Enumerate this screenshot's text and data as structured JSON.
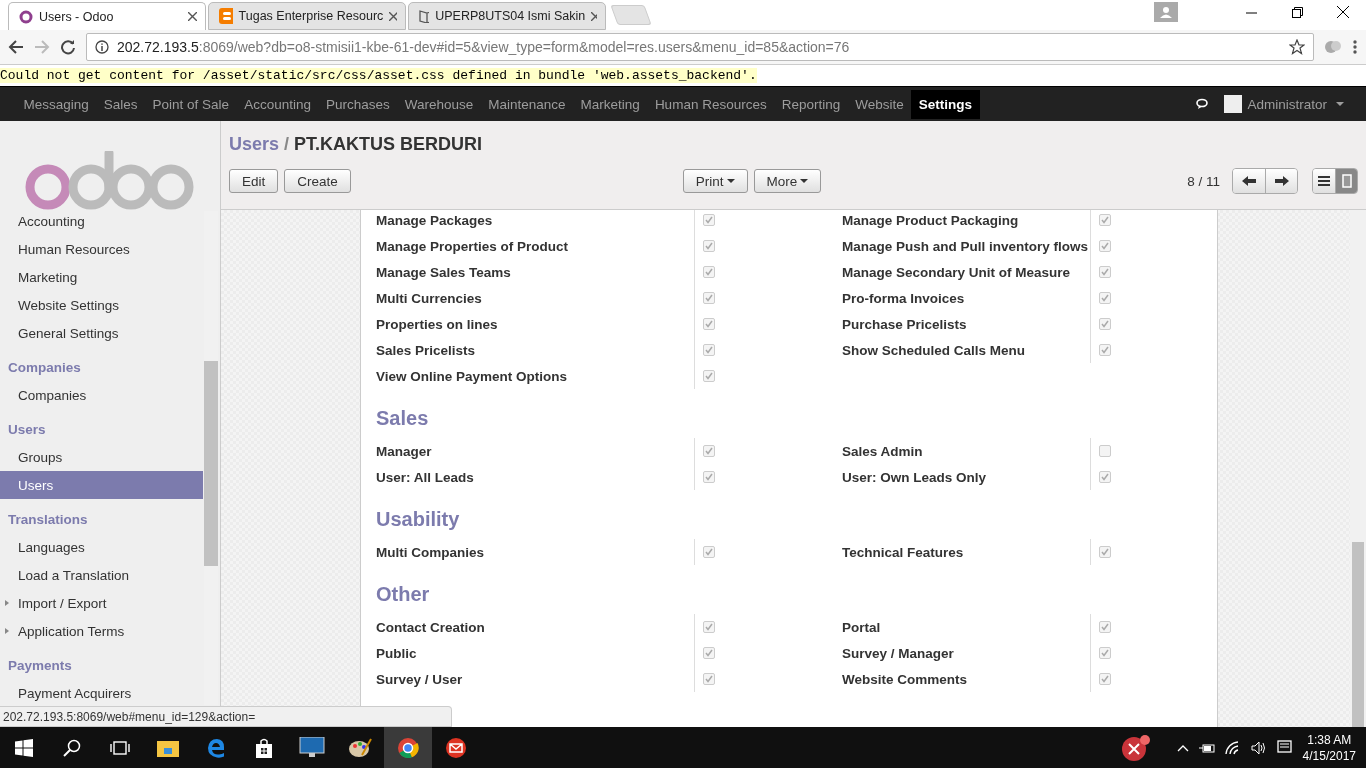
{
  "browser": {
    "tabs": [
      {
        "title": "Users - Odoo",
        "kind": "odoo",
        "selected": true
      },
      {
        "title": "Tugas Enterprise Resourc",
        "kind": "blogger",
        "selected": false
      },
      {
        "title": "UPERP8UTS04 Ismi Sakin",
        "kind": "book",
        "selected": false
      }
    ],
    "url": {
      "host": "202.72.193.5",
      "rest": ":8069/web?db=o8-stmisii1-kbe-61-dev#id=5&view_type=form&model=res.users&menu_id=85&action=76"
    }
  },
  "warning": "Could not get content for /asset/static/src/css/asset.css defined in bundle 'web.assets_backend'.",
  "top_menu": {
    "items": [
      {
        "label": "Messaging",
        "selected": false
      },
      {
        "label": "Sales",
        "selected": false
      },
      {
        "label": "Point of Sale",
        "selected": false
      },
      {
        "label": "Accounting",
        "selected": false
      },
      {
        "label": "Purchases",
        "selected": false
      },
      {
        "label": "Warehouse",
        "selected": false
      },
      {
        "label": "Maintenance",
        "selected": false
      },
      {
        "label": "Marketing",
        "selected": false
      },
      {
        "label": "Human Resources",
        "selected": false
      },
      {
        "label": "Reporting",
        "selected": false
      },
      {
        "label": "Website",
        "selected": false
      },
      {
        "label": "Settings",
        "selected": true
      }
    ],
    "user": "Administrator"
  },
  "sidebar": {
    "items": [
      {
        "kind": "item",
        "label": "Accounting",
        "selected": false
      },
      {
        "kind": "item",
        "label": "Human Resources",
        "selected": false
      },
      {
        "kind": "item",
        "label": "Marketing",
        "selected": false
      },
      {
        "kind": "item",
        "label": "Website Settings",
        "selected": false
      },
      {
        "kind": "item",
        "label": "General Settings",
        "selected": false
      },
      {
        "kind": "section",
        "label": "Companies",
        "selected": false
      },
      {
        "kind": "item",
        "label": "Companies",
        "selected": false
      },
      {
        "kind": "section",
        "label": "Users",
        "selected": false
      },
      {
        "kind": "item",
        "label": "Groups",
        "selected": false
      },
      {
        "kind": "item",
        "label": "Users",
        "selected": true
      },
      {
        "kind": "section",
        "label": "Translations",
        "selected": false
      },
      {
        "kind": "item",
        "label": "Languages",
        "selected": false
      },
      {
        "kind": "item",
        "label": "Load a Translation",
        "selected": false
      },
      {
        "kind": "folder",
        "label": "Import / Export",
        "selected": false
      },
      {
        "kind": "folder",
        "label": "Application Terms",
        "selected": false
      },
      {
        "kind": "section",
        "label": "Payments",
        "selected": false
      },
      {
        "kind": "item",
        "label": "Payment Acquirers",
        "selected": false
      }
    ]
  },
  "control_panel": {
    "breadcrumb": {
      "parent": "Users",
      "separator": "/",
      "current": "PT.KAKTUS BERDURI"
    },
    "buttons": [
      "Edit",
      "Create"
    ],
    "menus": [
      "Print",
      "More"
    ],
    "pager": "8 / 11",
    "views": [
      {
        "kind": "list",
        "selected": false
      },
      {
        "kind": "form",
        "selected": true
      }
    ]
  },
  "form": {
    "sections": [
      {
        "fields": [
          {
            "label": "Manage Packages",
            "checked": true
          },
          {
            "label": "Manage Product Packaging",
            "checked": true
          },
          {
            "label": "Manage Properties of Product",
            "checked": true
          },
          {
            "label": "Manage Push and Pull inventory flows",
            "checked": true
          },
          {
            "label": "Manage Sales Teams",
            "checked": true
          },
          {
            "label": "Manage Secondary Unit of Measure",
            "checked": true
          },
          {
            "label": "Multi Currencies",
            "checked": true
          },
          {
            "label": "Pro-forma Invoices",
            "checked": true
          },
          {
            "label": "Properties on lines",
            "checked": true
          },
          {
            "label": "Purchase Pricelists",
            "checked": true
          },
          {
            "label": "Sales Pricelists",
            "checked": true
          },
          {
            "label": "Show Scheduled Calls Menu",
            "checked": true
          },
          {
            "label": "View Online Payment Options",
            "checked": true
          }
        ]
      },
      {
        "title": "Sales",
        "fields": [
          {
            "label": "Manager",
            "checked": true
          },
          {
            "label": "Sales Admin",
            "checked": false
          },
          {
            "label": "User: All Leads",
            "checked": true
          },
          {
            "label": "User: Own Leads Only",
            "checked": true
          }
        ]
      },
      {
        "title": "Usability",
        "fields": [
          {
            "label": "Multi Companies",
            "checked": true
          },
          {
            "label": "Technical Features",
            "checked": true
          }
        ]
      },
      {
        "title": "Other",
        "fields": [
          {
            "label": "Contact Creation",
            "checked": true
          },
          {
            "label": "Portal",
            "checked": true
          },
          {
            "label": "Public",
            "checked": true
          },
          {
            "label": "Survey / Manager",
            "checked": true
          },
          {
            "label": "Survey / User",
            "checked": true
          },
          {
            "label": "Website Comments",
            "checked": true
          }
        ]
      }
    ]
  },
  "status_url": "202.72.193.5:8069/web#menu_id=129&action=",
  "taskbar": {
    "time": "1:38 AM",
    "date": "4/15/2017"
  }
}
